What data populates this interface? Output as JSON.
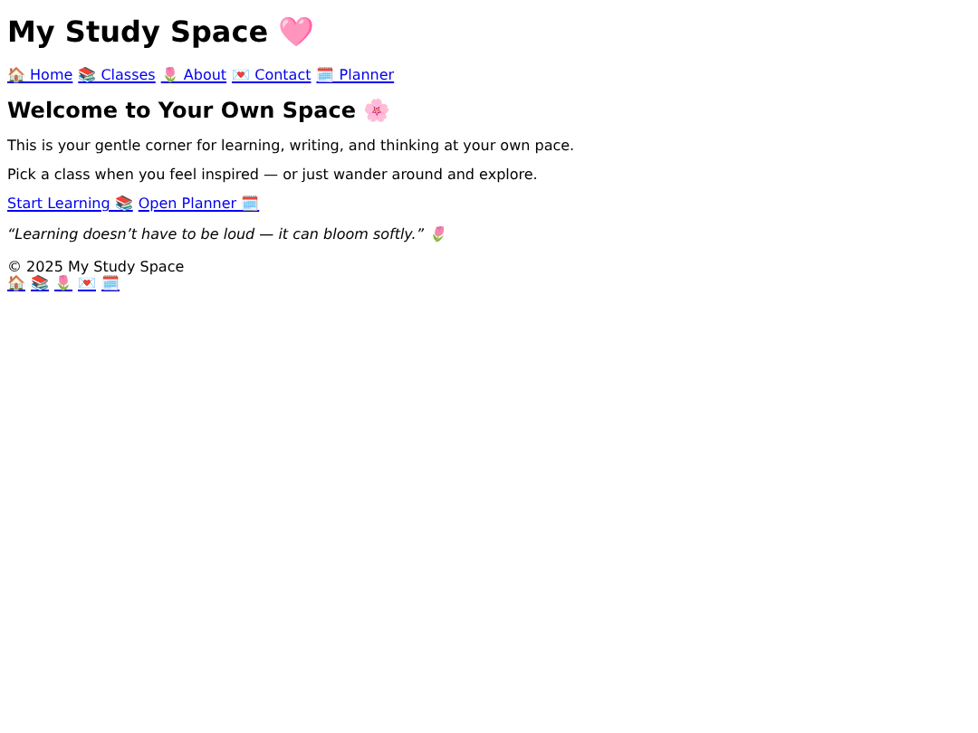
{
  "title": "My Study Space 🩷",
  "nav": [
    "🏠 Home",
    "📚 Classes",
    "🌷 About",
    "💌 Contact",
    "🗓️ Planner"
  ],
  "heading": "Welcome to Your Own Space 🌸",
  "paragraphs": [
    "This is your gentle corner for learning, writing, and thinking at your own pace.",
    "Pick a class when you feel inspired — or just wander around and explore."
  ],
  "actions": [
    "Start Learning 📚",
    "Open Planner 🗓️"
  ],
  "quote": "“Learning doesn’t have to be loud — it can bloom softly.” 🌷",
  "footer": {
    "copyright": "© 2025 My Study Space",
    "links": [
      "🏠",
      "📚",
      "🌷",
      "💌",
      "🗓️"
    ]
  }
}
